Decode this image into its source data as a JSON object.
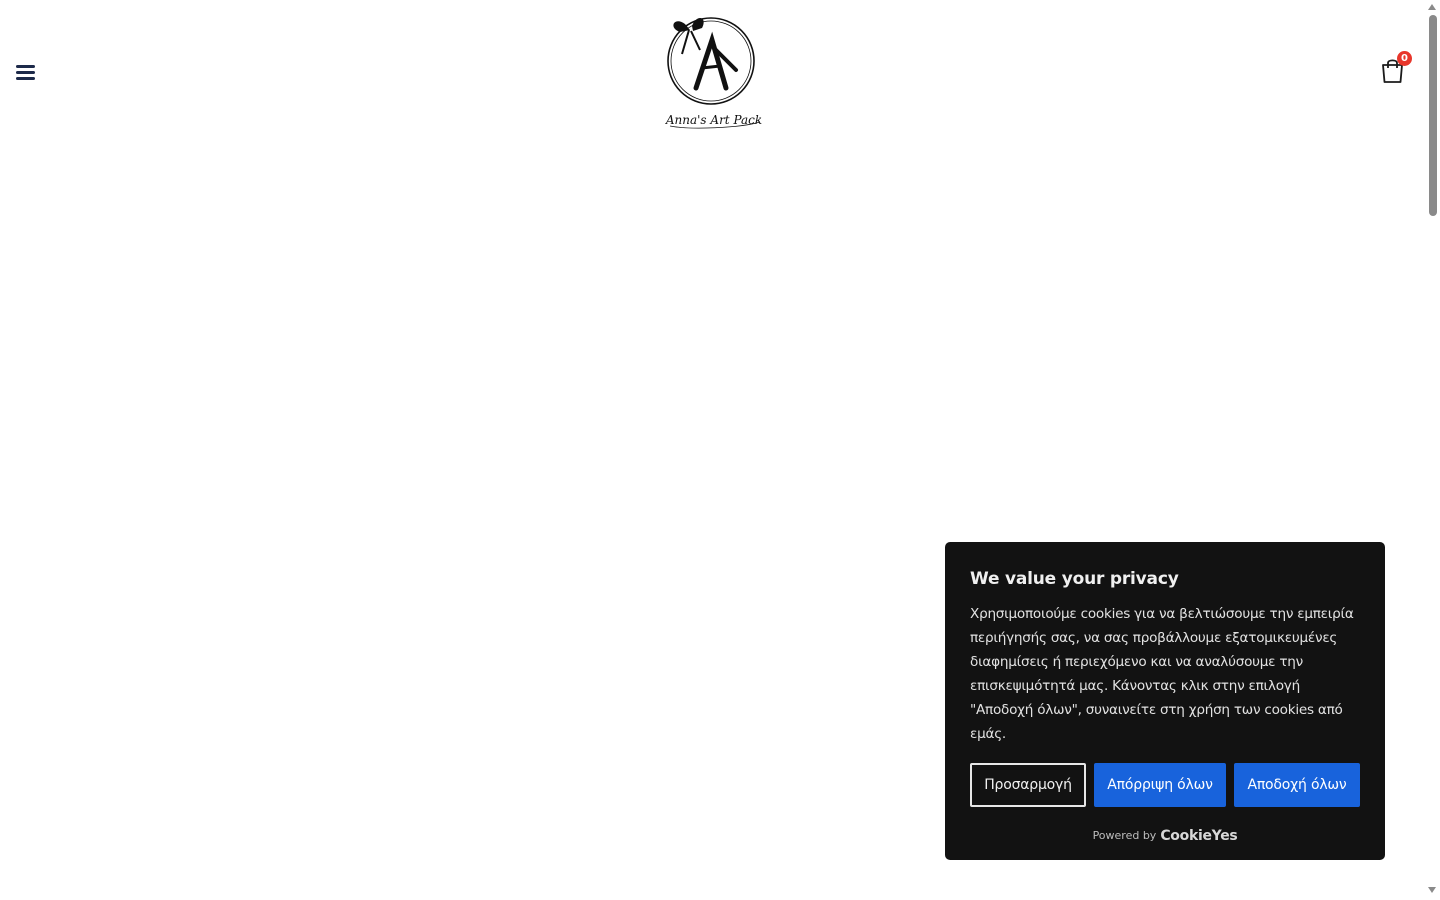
{
  "header": {
    "menu_icon": "hamburger-menu-icon",
    "logo_text": "Anna's Art Pack",
    "cart_icon": "shopping-bag-icon",
    "cart_count": "0"
  },
  "cookie_banner": {
    "title": "We value your privacy",
    "body": "Χρησιμοποιούμε cookies για να βελτιώσουμε την εμπειρία περιήγησής σας, να σας προβάλλουμε εξατομικευμένες διαφημίσεις ή περιεχόμενο και να αναλύσουμε την επισκεψιμότητά μας. Κάνοντας κλικ στην επιλογή \"Αποδοχή όλων\", συναινείτε στη χρήση των cookies από εμάς.",
    "customize_label": "Προσαρμογή",
    "reject_label": "Απόρριψη όλων",
    "accept_label": "Αποδοχή όλων",
    "powered_by": "Powered by",
    "brand": "CookieYes"
  },
  "colors": {
    "primary_button": "#1863dc",
    "banner_bg": "#121212",
    "badge": "#e8362b",
    "menu_icon": "#1d2a4a"
  }
}
